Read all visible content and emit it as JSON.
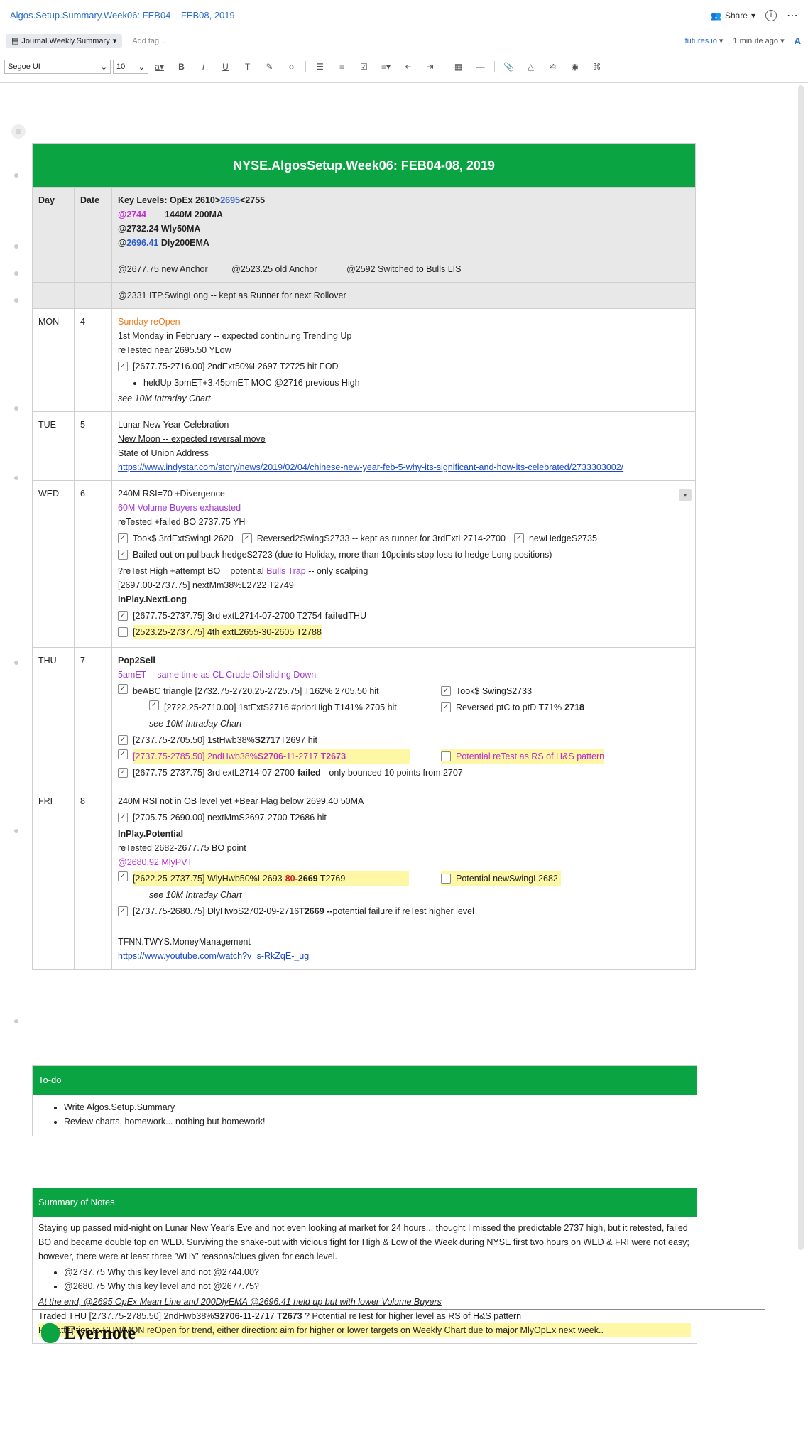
{
  "top": {
    "note_title": "Algos.Setup.Summary.Week06: FEB04 – FEB08, 2019",
    "share": "Share",
    "notebook": "Journal.Weekly.Summary",
    "add_tag": "Add tag...",
    "source": "futures.io",
    "updated": "1 minute ago"
  },
  "toolbar": {
    "font": "Segoe UI",
    "size": "10"
  },
  "colors": {
    "accent_green": "#0aa442",
    "link_blue": "#2a6fc9"
  },
  "table": {
    "title": "NYSE.AlgosSetup.Week06: FEB04-08, 2019",
    "col_day": "Day",
    "col_date": "Date",
    "key_levels": {
      "l1a": "Key Levels:  OpEx 2610>",
      "l1b": "2695",
      "l1c": "<2755",
      "l2a": "@2744",
      "l2b": "1440M 200MA",
      "l3": "@2732.24 Wly50MA",
      "l4a": "@",
      "l4b": "2696.41",
      "l4c": " Dly200EMA"
    },
    "anchors": {
      "a1": "@2677.75 new Anchor",
      "a2": "@2523.25 old Anchor",
      "a3": "@2592 Switched to Bulls LIS"
    },
    "runner": "@2331 ITP.SwingLong -- kept as Runner for next Rollover",
    "mon": {
      "day": "MON",
      "date": "4",
      "l1": "Sunday reOpen",
      "l2": "1st Monday in February -- expected continuing Trending Up",
      "l3": "reTested near 2695.50 YLow",
      "l4": "[2677.75-2716.00] 2ndExt50%L2697 T2725 hit EOD",
      "l5": "heldUp 3pmET+3.45pmET MOC @2716 previous High",
      "l6": "see 10M Intraday Chart"
    },
    "tue": {
      "day": "TUE",
      "date": "5",
      "l1": "Lunar New Year Celebration",
      "l2": "New Moon  -- expected reversal move",
      "l3": "State of Union Address",
      "l4": "https://www.indystar.com/story/news/2019/02/04/chinese-new-year-feb-5-why-its-significant-and-how-its-celebrated/2733303002/"
    },
    "wed": {
      "day": "WED",
      "date": "6",
      "l1": "240M RSI=70 +Divergence",
      "l2": "60M  Volume Buyers exhausted",
      "l3": "reTested +failed BO 2737.75 YH",
      "c1": "Took$ 3rdExtSwingL2620",
      "c2": "Reversed2SwingS2733 -- kept as runner for 3rdExtL2714-2700",
      "c3": "newHedgeS2735",
      "c4": "Bailed out on pullback hedgeS2723 (due to Holiday, more than 10points stop loss to hedge Long positions)",
      "l4a": "?reTest High +attempt BO = potential ",
      "l4b": "Bulls Trap",
      "l4c": " -- only scalping",
      "l5": "[2697.00-2737.75] nextMm38%L2722 T2749",
      "l6": "InPlay.NextLong",
      "c5a": "[2677.75-2737.75] 3rd extL2714-07-2700  T2754 ",
      "c5b": "failed",
      "c5c": " THU",
      "c6": "[2523.25-2737.75] 4th extL2655-30-2605  T2788"
    },
    "thu": {
      "day": "THU",
      "date": "7",
      "l1": "Pop2Sell",
      "l2": "5amET -- same time as CL Crude Oil  sliding Down",
      "c1": "beABC triangle [2732.75-2720.25-2725.75] T162% 2705.50 hit",
      "c2": "Took$ SwingS2733",
      "c3": "[2722.25-2710.00] 1stExtS2716 #priorHigh T141% 2705 hit",
      "c4a": "Reversed ptC to ptD T71% ",
      "c4b": "2718",
      "l3": "see 10M Intraday Chart",
      "c5a": "[2737.75-2705.50] 1stHwb38%",
      "c5b": "S2717",
      "c5c": " T2697 hit",
      "c6a": "[2737.75-2785.50] 2ndHwb38%",
      "c6b": "S2706",
      "c6c": "-11-2717 ",
      "c6d": "T2673",
      "c7": "Potential reTest as RS of H&S pattern",
      "c8a": "[2677.75-2737.75] 3rd extL2714-07-2700 ",
      "c8b": "failed",
      "c8c": " -- only bounced 10 points from 2707"
    },
    "fri": {
      "day": "FRI",
      "date": "8",
      "l1": "240M RSI not in OB level yet +Bear Flag below 2699.40 50MA",
      "c1": "[2705.75-2690.00] nextMmS2697-2700 T2686 hit",
      "l2": "InPlay.Potential",
      "l3": "reTested 2682-2677.75 BO point",
      "l4": "@2680.92 MlyPVT",
      "c2a": "[2622.25-2737.75] WlyHwb50%L2693-",
      "c2b": "80",
      "c2c": "-2669",
      "c2d": "  T2769",
      "c3": "Potential newSwingL2682",
      "l5": "see 10M Intraday Chart",
      "c4a": "[2737.75-2680.75] DlyHwbS2702-09-2716  ",
      "c4b": "T2669 --",
      "c4c": " potential failure if reTest higher level",
      "l6": "TFNN.TWYS.MoneyManagement",
      "l7": "https://www.youtube.com/watch?v=s-RkZqE-_ug"
    }
  },
  "todo": {
    "title": "To-do",
    "items": [
      "Write Algos.Setup.Summary",
      "Review charts, homework... nothing but homework!"
    ]
  },
  "summary": {
    "title": "Summary of Notes",
    "p1": "Staying up passed mid-night on Lunar New Year's Eve and not even looking at market for 24 hours... thought I missed the predictable 2737 high, but it retested, failed BO and became double top on WED.  Surviving the shake-out with vicious fight for High & Low of the Week during NYSE first two hours on WED & FRI were not easy; however, there were at least three 'WHY' reasons/clues given for each level.",
    "b1": "@2737.75 Why this key level and not @2744.00?",
    "b2": "@2680.75 Why this key level and not @2677.75?",
    "p2": "At the end, @2695 OpEx Mean Line and 200DlyEMA @2696.41 held up but with lower Volume Buyers",
    "p3a": "Traded THU [2737.75-2785.50] 2ndHwb38%",
    "p3b": "S2706",
    "p3c": "-11-2717 ",
    "p3d": "T2673",
    "p3e": "   ? Potential reTest for higher level as RS of H&S pattern",
    "p4": "Pay attention to SUN/MON reOpen for trend, either direction: aim for higher or lower targets on Weekly Chart due to major MlyOpEx next week.."
  },
  "footer": {
    "logo_text": "Evernote"
  }
}
